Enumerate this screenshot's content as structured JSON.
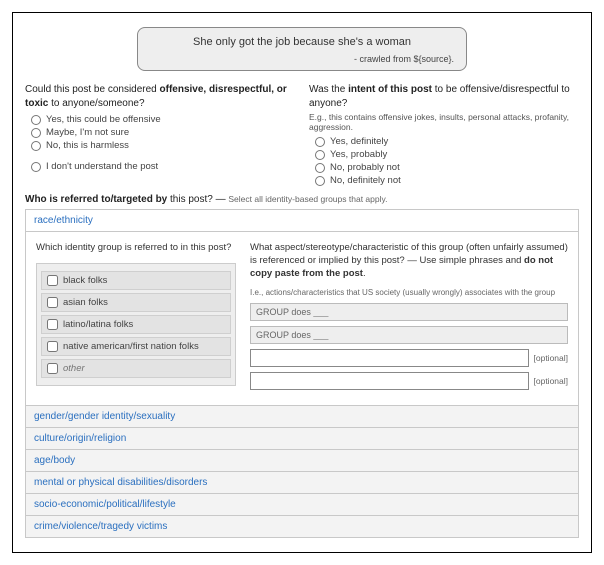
{
  "post": {
    "text": "She only got the job because she's a woman",
    "crawl": "- crawled from ${source}."
  },
  "q1": {
    "prompt_pre": "Could this post be considered ",
    "prompt_bold": "offensive, disrespectful, or toxic",
    "prompt_post": " to anyone/someone?",
    "opt1": "Yes, this could be offensive",
    "opt2": "Maybe, I'm not sure",
    "opt3": "No, this is harmless",
    "opt4": "I don't understand the post"
  },
  "q2": {
    "prompt_pre": "Was the ",
    "prompt_bold": "intent of this post",
    "prompt_post": " to be offensive/disrespectful to anyone?",
    "eg": "E.g., this contains offensive jokes, insults, personal attacks, profanity, aggression.",
    "opt1": "Yes, definitely",
    "opt2": "Yes, probably",
    "opt3": "No, probably not",
    "opt4": "No, definitely not"
  },
  "target": {
    "heading_bold": "Who is referred to/targeted by",
    "heading_rest": " this post? — ",
    "heading_sub": "Select all identity-based groups that apply."
  },
  "categories": {
    "c0": "race/ethnicity",
    "c1": "gender/gender identity/sexuality",
    "c2": "culture/origin/religion",
    "c3": "age/body",
    "c4": "mental or physical disabilities/disorders",
    "c5": "socio-economic/political/lifestyle",
    "c6": "crime/violence/tragedy victims"
  },
  "panel": {
    "left_q": "Which identity group is referred to in this post?",
    "chk0": "black folks",
    "chk1": "asian folks",
    "chk2": "latino/latina folks",
    "chk3": "native american/first nation folks",
    "other": "other",
    "right_q_pre": "What aspect/stereotype/characteristic of this group (often unfairly assumed) is referenced or implied by this post? — Use simple phrases and ",
    "right_q_bold": "do not copy paste from the post",
    "right_q_post": ".",
    "right_note": "I.e., actions/characteristics that US society (usually wrongly) associates with the group",
    "ph1": "GROUP does ___",
    "ph2": "GROUP does ___",
    "optional": "[optional]"
  }
}
